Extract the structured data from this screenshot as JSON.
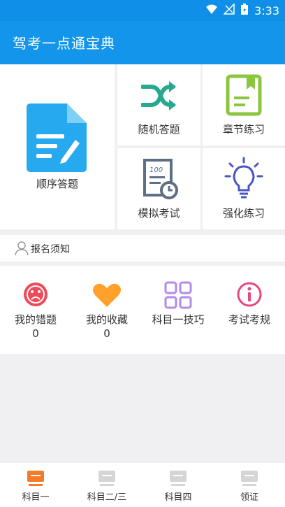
{
  "status": {
    "time": "3:33"
  },
  "app": {
    "title": "驾考一点通宝典"
  },
  "grid": {
    "sequential": "顺序答题",
    "random": "随机答题",
    "chapter": "章节练习",
    "mock": "模拟考试",
    "intensive": "强化练习"
  },
  "notice": {
    "label": "报名须知"
  },
  "features": [
    {
      "label": "我的错题",
      "count": "0"
    },
    {
      "label": "我的收藏",
      "count": "0"
    },
    {
      "label": "科目一技巧"
    },
    {
      "label": "考试考规"
    }
  ],
  "tabs": [
    {
      "label": "科目一"
    },
    {
      "label": "科目二/三"
    },
    {
      "label": "科目四"
    },
    {
      "label": "领证"
    }
  ],
  "colors": {
    "primary": "#1295ea",
    "active_tab": "#f47b2a",
    "inactive_tab": "#d5d5d5"
  }
}
